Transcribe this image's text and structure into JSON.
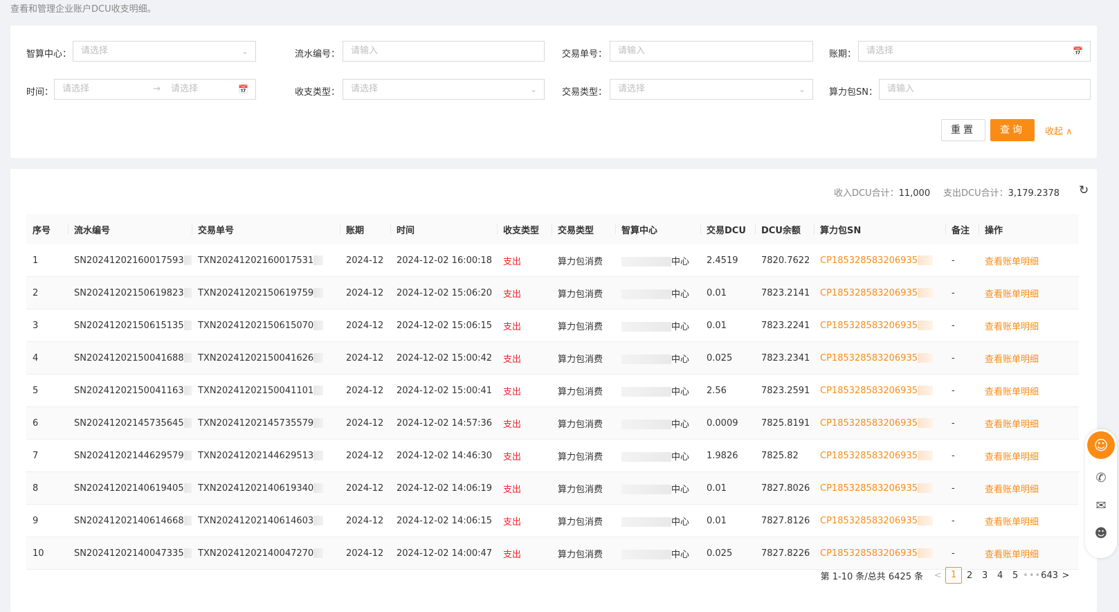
{
  "page": {
    "description": "查看和管理企业账户DCU收支明细。"
  },
  "filters": {
    "center": {
      "label": "智算中心：",
      "placeholder": "请选择"
    },
    "serial": {
      "label": "流水编号：",
      "placeholder": "请输入"
    },
    "trade_no": {
      "label": "交易单号：",
      "placeholder": "请输入"
    },
    "period": {
      "label": "账期：",
      "placeholder": "请选择"
    },
    "time": {
      "label": "时间：",
      "start_placeholder": "请选择",
      "end_placeholder": "请选择",
      "separator": "→"
    },
    "io_type": {
      "label": "收支类型：",
      "placeholder": "请选择"
    },
    "trade_type": {
      "label": "交易类型：",
      "placeholder": "请选择"
    },
    "pack_sn": {
      "label": "算力包SN：",
      "placeholder": "请输入"
    },
    "reset_label": "重置",
    "query_label": "查询",
    "collapse_label": "收起 ∧"
  },
  "summary": {
    "income_label": "收入DCU合计：",
    "income_value": "11,000",
    "expense_label": "支出DCU合计：",
    "expense_value": "3,179.2378"
  },
  "table": {
    "columns": [
      "序号",
      "流水编号",
      "交易单号",
      "账期",
      "时间",
      "收支类型",
      "交易类型",
      "智算中心",
      "交易DCU",
      "DCU余额",
      "算力包SN",
      "备注",
      "操作"
    ],
    "rows": [
      {
        "idx": "1",
        "serial": "SN20241202160017593",
        "trade": "TXN20241202160017531",
        "period": "2024-12",
        "time": "2024-12-02 16:00:18",
        "io": "支出",
        "type": "算力包消费",
        "center": "中心",
        "dcu": "2.4519",
        "balance": "7820.7622",
        "sn": "CP185328583206935",
        "note": "-",
        "op": "查看账单明细"
      },
      {
        "idx": "2",
        "serial": "SN20241202150619823",
        "trade": "TXN20241202150619759",
        "period": "2024-12",
        "time": "2024-12-02 15:06:20",
        "io": "支出",
        "type": "算力包消费",
        "center": "中心",
        "dcu": "0.01",
        "balance": "7823.2141",
        "sn": "CP185328583206935",
        "note": "-",
        "op": "查看账单明细"
      },
      {
        "idx": "3",
        "serial": "SN20241202150615135",
        "trade": "TXN20241202150615070",
        "period": "2024-12",
        "time": "2024-12-02 15:06:15",
        "io": "支出",
        "type": "算力包消费",
        "center": "中心",
        "dcu": "0.01",
        "balance": "7823.2241",
        "sn": "CP185328583206935",
        "note": "-",
        "op": "查看账单明细"
      },
      {
        "idx": "4",
        "serial": "SN20241202150041688",
        "trade": "TXN20241202150041626",
        "period": "2024-12",
        "time": "2024-12-02 15:00:42",
        "io": "支出",
        "type": "算力包消费",
        "center": "中心",
        "dcu": "0.025",
        "balance": "7823.2341",
        "sn": "CP185328583206935",
        "note": "-",
        "op": "查看账单明细"
      },
      {
        "idx": "5",
        "serial": "SN20241202150041163",
        "trade": "TXN20241202150041101",
        "period": "2024-12",
        "time": "2024-12-02 15:00:41",
        "io": "支出",
        "type": "算力包消费",
        "center": "中心",
        "dcu": "2.56",
        "balance": "7823.2591",
        "sn": "CP185328583206935",
        "note": "-",
        "op": "查看账单明细"
      },
      {
        "idx": "6",
        "serial": "SN20241202145735645",
        "trade": "TXN20241202145735579",
        "period": "2024-12",
        "time": "2024-12-02 14:57:36",
        "io": "支出",
        "type": "算力包消费",
        "center": "中心",
        "dcu": "0.0009",
        "balance": "7825.8191",
        "sn": "CP185328583206935",
        "note": "-",
        "op": "查看账单明细"
      },
      {
        "idx": "7",
        "serial": "SN20241202144629579",
        "trade": "TXN20241202144629513",
        "period": "2024-12",
        "time": "2024-12-02 14:46:30",
        "io": "支出",
        "type": "算力包消费",
        "center": "中心",
        "dcu": "1.9826",
        "balance": "7825.82",
        "sn": "CP185328583206935",
        "note": "-",
        "op": "查看账单明细"
      },
      {
        "idx": "8",
        "serial": "SN20241202140619405",
        "trade": "TXN20241202140619340",
        "period": "2024-12",
        "time": "2024-12-02 14:06:19",
        "io": "支出",
        "type": "算力包消费",
        "center": "中心",
        "dcu": "0.01",
        "balance": "7827.8026",
        "sn": "CP185328583206935",
        "note": "-",
        "op": "查看账单明细"
      },
      {
        "idx": "9",
        "serial": "SN20241202140614668",
        "trade": "TXN20241202140614603",
        "period": "2024-12",
        "time": "2024-12-02 14:06:15",
        "io": "支出",
        "type": "算力包消费",
        "center": "中心",
        "dcu": "0.01",
        "balance": "7827.8126",
        "sn": "CP185328583206935",
        "note": "-",
        "op": "查看账单明细"
      },
      {
        "idx": "10",
        "serial": "SN20241202140047335",
        "trade": "TXN20241202140047270",
        "period": "2024-12",
        "time": "2024-12-02 14:00:47",
        "io": "支出",
        "type": "算力包消费",
        "center": "中心",
        "dcu": "0.025",
        "balance": "7827.8226",
        "sn": "CP185328583206935",
        "note": "-",
        "op": "查看账单明细"
      }
    ]
  },
  "pagination": {
    "total_text": "第 1-10 条/总共 6425 条",
    "pages": [
      "1",
      "2",
      "3",
      "4",
      "5"
    ],
    "ellipsis": "•••",
    "last": "643",
    "prev": "<",
    "next": ">",
    "current": "1"
  },
  "colors": {
    "accent": "#fa8c16",
    "expense": "#f5222d"
  },
  "icons": {
    "refresh": "refresh-icon",
    "calendar": "calendar-icon",
    "chevron": "chevron-down-icon",
    "phone": "phone-icon",
    "mail": "mail-icon",
    "service": "customer-service-icon"
  }
}
